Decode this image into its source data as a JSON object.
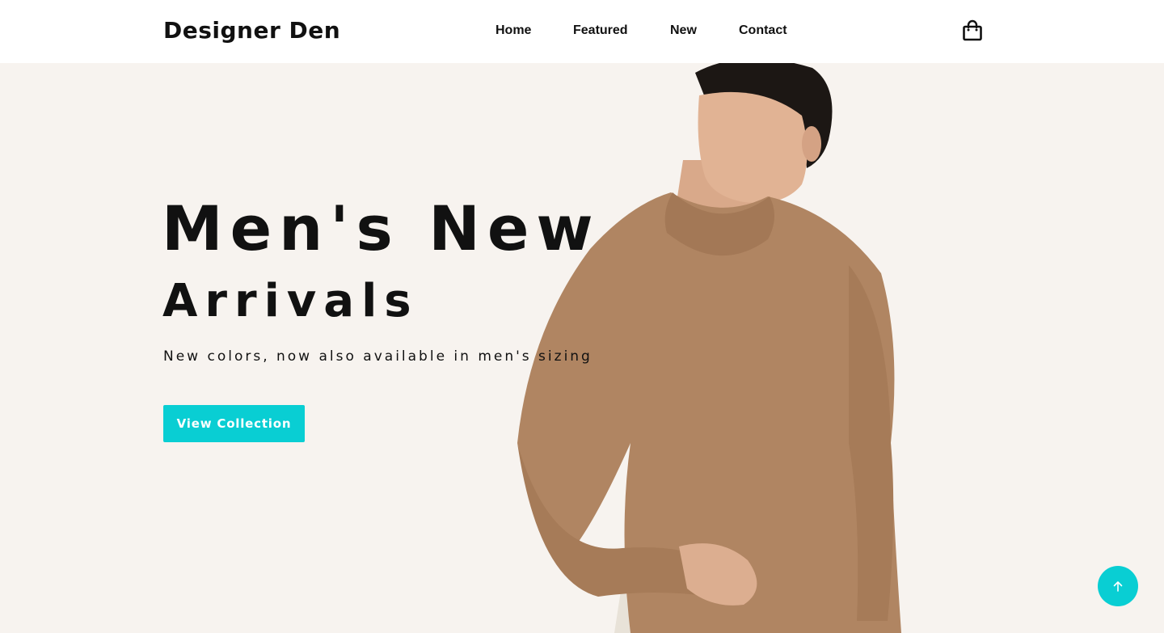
{
  "header": {
    "logo": "Designer Den",
    "nav": [
      {
        "label": "Home"
      },
      {
        "label": "Featured"
      },
      {
        "label": "New"
      },
      {
        "label": "Contact"
      }
    ],
    "cart_icon": "shopping-bag-icon"
  },
  "hero": {
    "headline_line1": "Men's New",
    "headline_line2": "Arrivals",
    "subtitle": "New colors, now also available in men's sizing",
    "cta_label": "View Collection",
    "image": "man-in-brown-knit-sweater"
  },
  "scroll_top_icon": "arrow-up-icon",
  "colors": {
    "accent": "#09ced3",
    "background": "#f7f3ef",
    "header_bg": "#ffffff",
    "text": "#111111",
    "sweater": "#b08562"
  }
}
